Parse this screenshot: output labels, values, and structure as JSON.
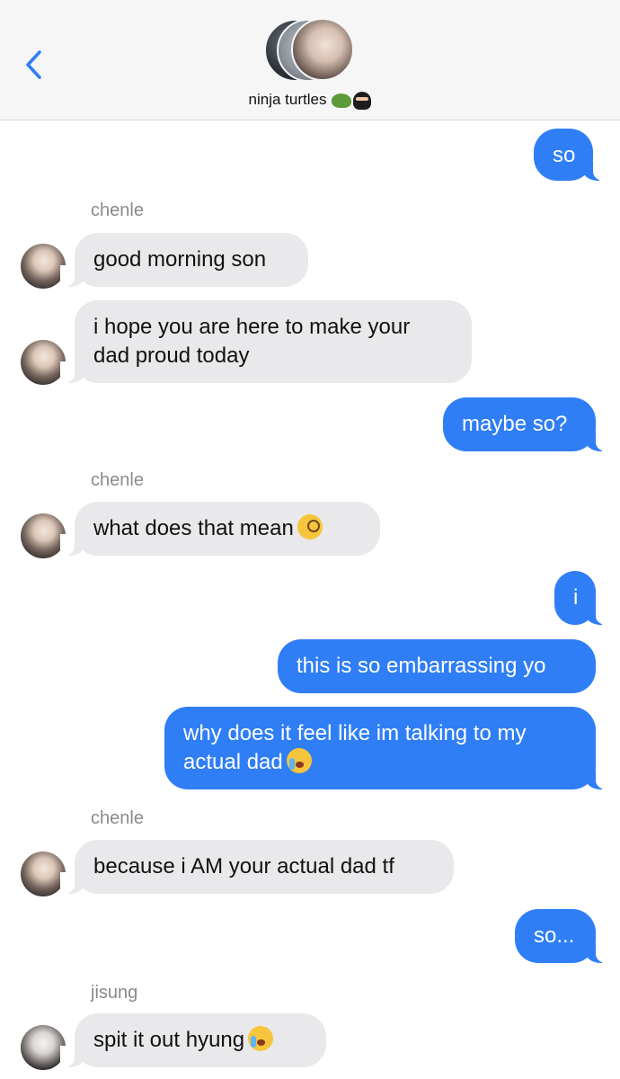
{
  "header": {
    "back_icon": "chevron-left-icon",
    "title": "ninja turtles",
    "title_emojis": [
      "turtle-emoji",
      "ninja-emoji"
    ],
    "accent_color": "#2f7ef6",
    "background_color": "#f6f6f7"
  },
  "messages": [
    {
      "direction": "outgoing",
      "text": "so"
    },
    {
      "direction": "incoming",
      "sender": "chenle",
      "text": "good morning son"
    },
    {
      "direction": "incoming",
      "text": "i hope you are here to make your"
    },
    {
      "direction": "incoming",
      "text": "dad proud today"
    },
    {
      "direction": "outgoing",
      "text": "maybe so?"
    },
    {
      "direction": "incoming",
      "sender": "chenle",
      "text": "what does that mean",
      "emoji": "face-with-monocle-emoji"
    },
    {
      "direction": "outgoing",
      "text": "i"
    },
    {
      "direction": "outgoing",
      "text": "this is so embarrassing yo"
    },
    {
      "direction": "outgoing",
      "text": "why does it feel like im talking to my"
    },
    {
      "direction": "outgoing",
      "text": "actual dad",
      "emoji": "loudly-crying-face-emoji"
    },
    {
      "direction": "incoming",
      "sender": "chenle",
      "text": "because i AM your actual dad tf"
    },
    {
      "direction": "outgoing",
      "text": "so..."
    },
    {
      "direction": "incoming",
      "sender": "jisung",
      "text": "spit it out hyung",
      "emoji": "loudly-crying-face-emoji"
    }
  ],
  "colors": {
    "outgoing_bubble": "#2f7ef6",
    "incoming_bubble": "#e9e9eb",
    "sender_label": "#8a8a8e"
  }
}
